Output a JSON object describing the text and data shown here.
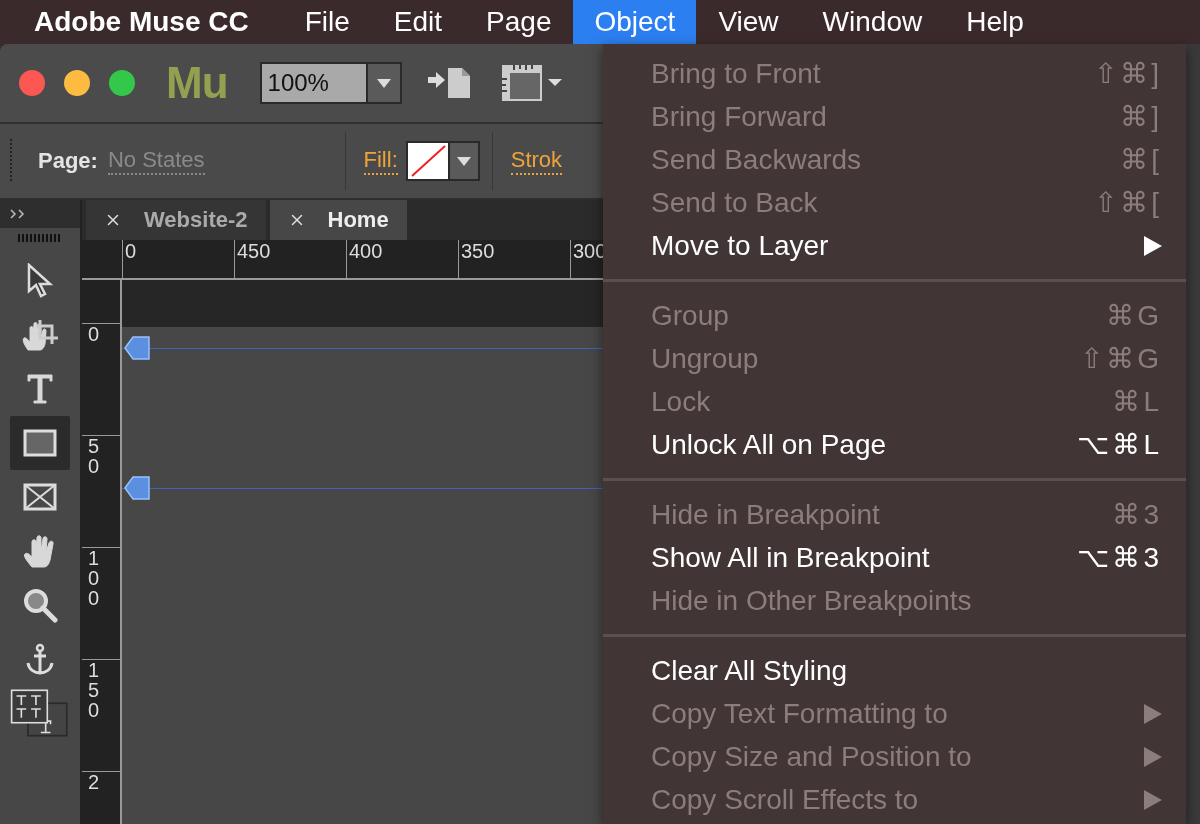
{
  "menu_bar": {
    "app_name": "Adobe Muse CC",
    "items": [
      {
        "label": "File",
        "selected": false
      },
      {
        "label": "Edit",
        "selected": false
      },
      {
        "label": "Page",
        "selected": false
      },
      {
        "label": "Object",
        "selected": true
      },
      {
        "label": "View",
        "selected": false
      },
      {
        "label": "Window",
        "selected": false
      },
      {
        "label": "Help",
        "selected": false
      }
    ]
  },
  "toolbar": {
    "logo": "Mu",
    "zoom": "100%"
  },
  "control_bar": {
    "page_label": "Page:",
    "page_state": "No States",
    "fill_label": "Fill:",
    "stroke_label": "Strok"
  },
  "tabs": [
    {
      "label": "Website-2",
      "selected": false
    },
    {
      "label": "Home",
      "selected": true
    }
  ],
  "tools": [
    {
      "kind": "select",
      "selected": false
    },
    {
      "kind": "crop",
      "selected": false
    },
    {
      "kind": "text",
      "selected": false
    },
    {
      "kind": "rectangle",
      "selected": true
    },
    {
      "kind": "image-frame",
      "selected": false
    },
    {
      "kind": "hand",
      "selected": false
    },
    {
      "kind": "zoom",
      "selected": false
    },
    {
      "kind": "anchor",
      "selected": false
    },
    {
      "kind": "text-frames",
      "selected": false
    }
  ],
  "ruler": {
    "horizontal": [
      "0",
      "450",
      "400",
      "350",
      "300"
    ],
    "vertical": [
      "0",
      "50",
      "100",
      "150",
      "2"
    ]
  },
  "object_menu": {
    "groups": [
      [
        {
          "label": "Bring to Front",
          "shortcut": "⇧⌘]",
          "disabled": true,
          "submenu": false
        },
        {
          "label": "Bring Forward",
          "shortcut": "⌘]",
          "disabled": true,
          "submenu": false
        },
        {
          "label": "Send Backwards",
          "shortcut": "⌘[",
          "disabled": true,
          "submenu": false
        },
        {
          "label": "Send to Back",
          "shortcut": "⇧⌘[",
          "disabled": true,
          "submenu": false
        },
        {
          "label": "Move to Layer",
          "disabled": false,
          "submenu": true
        }
      ],
      [
        {
          "label": "Group",
          "shortcut": "⌘G",
          "disabled": true,
          "submenu": false
        },
        {
          "label": "Ungroup",
          "shortcut": "⇧⌘G",
          "disabled": true,
          "submenu": false
        },
        {
          "label": "Lock",
          "shortcut": "⌘L",
          "disabled": true,
          "submenu": false
        },
        {
          "label": "Unlock All on Page",
          "shortcut": "⌥⌘L",
          "disabled": false,
          "submenu": false
        }
      ],
      [
        {
          "label": "Hide in Breakpoint",
          "shortcut": "⌘3",
          "disabled": true,
          "submenu": false
        },
        {
          "label": "Show All in Breakpoint",
          "shortcut": "⌥⌘3",
          "disabled": false,
          "submenu": false
        },
        {
          "label": "Hide in Other Breakpoints",
          "disabled": true,
          "submenu": false
        }
      ],
      [
        {
          "label": "Clear All Styling",
          "disabled": false,
          "submenu": false
        },
        {
          "label": "Copy Text Formatting to",
          "disabled": true,
          "submenu": true
        },
        {
          "label": "Copy Size and Position to",
          "disabled": true,
          "submenu": true
        },
        {
          "label": "Copy Scroll Effects to",
          "disabled": true,
          "submenu": true
        }
      ]
    ]
  }
}
